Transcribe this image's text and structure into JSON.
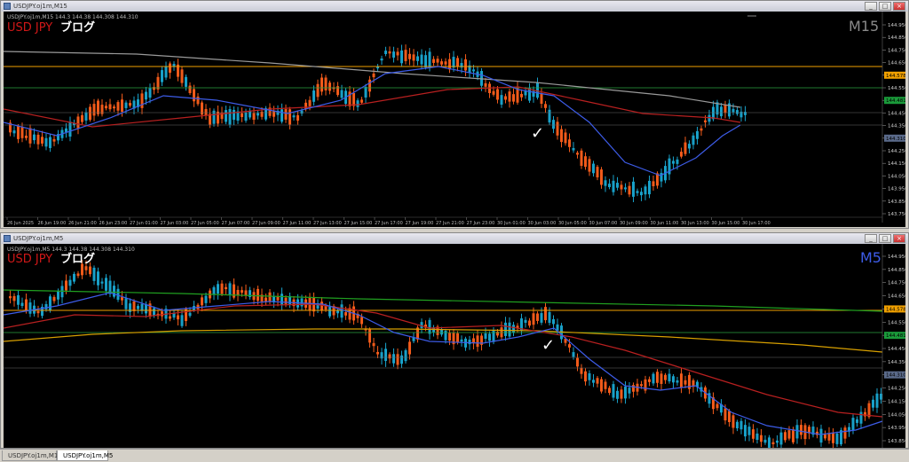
{
  "top_window": {
    "title": "USDJPY.oj1m,M15",
    "info_line": "USDJPY.oj1m,M15  144.3 144.38 144.308 144.310",
    "brand": "USD JPY",
    "blog": "ブログ",
    "timeframe": "M15",
    "price_scale": [
      "144.950",
      "144.850",
      "144.750",
      "144.650",
      "144.578",
      "144.550",
      "144.481",
      "144.450",
      "144.350",
      "144.310",
      "144.250",
      "144.150",
      "144.050",
      "143.950",
      "143.850",
      "143.750"
    ],
    "price_tags": [
      {
        "value": "144.578",
        "color": "#f0a000"
      },
      {
        "value": "144.481",
        "color": "#1a9a3a"
      },
      {
        "value": "144.310",
        "color": "#5a6a8a"
      }
    ],
    "time_axis": [
      "26 Jun 2025",
      "26 Jun 19:00",
      "26 Jun 21:00",
      "26 Jun 23:00",
      "27 Jun 01:00",
      "27 Jun 03:00",
      "27 Jun 05:00",
      "27 Jun 07:00",
      "27 Jun 09:00",
      "27 Jun 11:00",
      "27 Jun 13:00",
      "27 Jun 15:00",
      "27 Jun 17:00",
      "27 Jun 19:00",
      "27 Jun 21:00",
      "27 Jun 23:00",
      "30 Jun 01:00",
      "30 Jun 03:00",
      "30 Jun 05:00",
      "30 Jun 07:00",
      "30 Jun 09:00",
      "30 Jun 11:00",
      "30 Jun 13:00",
      "30 Jun 15:00",
      "30 Jun 17:00"
    ],
    "checkmark": "✓",
    "colors": {
      "bull": "#18a0c8",
      "bear": "#f05a1a",
      "ma_fast": "#3d5ce8",
      "ma_mid": "#b82020",
      "ma_slow": "#9a9a9a",
      "level_orange": "#f0a000",
      "level_green": "#2aa040"
    }
  },
  "bottom_window": {
    "title": "USDJPY.oj1m,M5",
    "info_line": "USDJPY.oj1m,M5  144.3 144.38 144.308 144.310",
    "brand": "USD JPY",
    "blog": "ブログ",
    "timeframe": "M5",
    "price_scale": [
      "144.950",
      "144.850",
      "144.750",
      "144.650",
      "144.578",
      "144.550",
      "144.481",
      "144.450",
      "144.350",
      "144.310",
      "144.250",
      "144.150",
      "144.050",
      "143.950",
      "143.850"
    ],
    "price_tags": [
      {
        "value": "144.578",
        "color": "#f0a000"
      },
      {
        "value": "144.481",
        "color": "#1a9a3a"
      },
      {
        "value": "144.310",
        "color": "#5a6a8a"
      }
    ],
    "checkmark": "✓",
    "colors": {
      "bull": "#18a0c8",
      "bear": "#f05a1a",
      "ma_fast": "#3d5ce8",
      "ma_mid": "#b82020",
      "ma_slow": "#d8a000",
      "ma_long": "#20a020"
    }
  },
  "tabs": [
    "USDJPY.oj1m,M15",
    "USDJPY.oj1m,M5"
  ],
  "active_tab": 1
}
